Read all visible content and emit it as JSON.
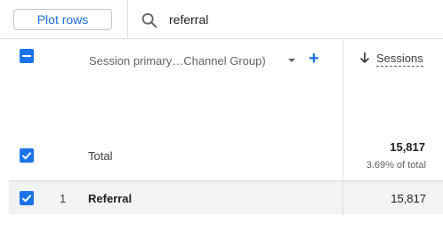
{
  "toolbar": {
    "plot_rows_label": "Plot rows",
    "search_value": "referral",
    "search_icon": "search-icon"
  },
  "table": {
    "dimension_header": "Session primary…Channel Group)",
    "add_dimension_label": "+",
    "metric_header": "Sessions",
    "sort_direction": "descending",
    "total": {
      "label": "Total",
      "value": "15,817",
      "percent": "3.69% of total"
    },
    "rows": [
      {
        "index": "1",
        "dimension": "Referral",
        "sessions": "15,817"
      }
    ]
  },
  "colors": {
    "accent": "#1a73e8",
    "row_highlight": "#f1f3f4"
  }
}
